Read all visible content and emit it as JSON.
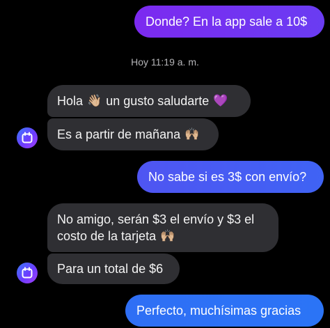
{
  "messages": [
    {
      "side": "out",
      "text": "Donde? En la app sale a 10$"
    },
    {
      "side": "in",
      "text": "Hola",
      "emoji": "👋🏼",
      "text2": "un gusto saludarte",
      "emoji2": "💜"
    },
    {
      "side": "in",
      "text": "Es a partir de mañana",
      "emoji": "🙌🏼"
    },
    {
      "side": "out",
      "text": "No sabe si es 3$ con envío?"
    },
    {
      "side": "in",
      "line1": "No amigo, serán $3 el envío y $3 el",
      "line2": "costo de la tarjeta",
      "emoji": "🙌🏼"
    },
    {
      "side": "in",
      "text": "Para un total de $6"
    },
    {
      "side": "out",
      "text": "Perfecto, muchísimas gracias"
    }
  ],
  "timestamp": "Hoy 11:19 a. m.",
  "colors": {
    "background": "#000000",
    "incoming_bubble": "#2f2f33",
    "outgoing_gradient_start": "#7a2cf0",
    "outgoing_gradient_end": "#2e72f5",
    "timestamp_text": "#b5b5b8"
  },
  "icons": {
    "avatar": "store-logo-icon"
  }
}
